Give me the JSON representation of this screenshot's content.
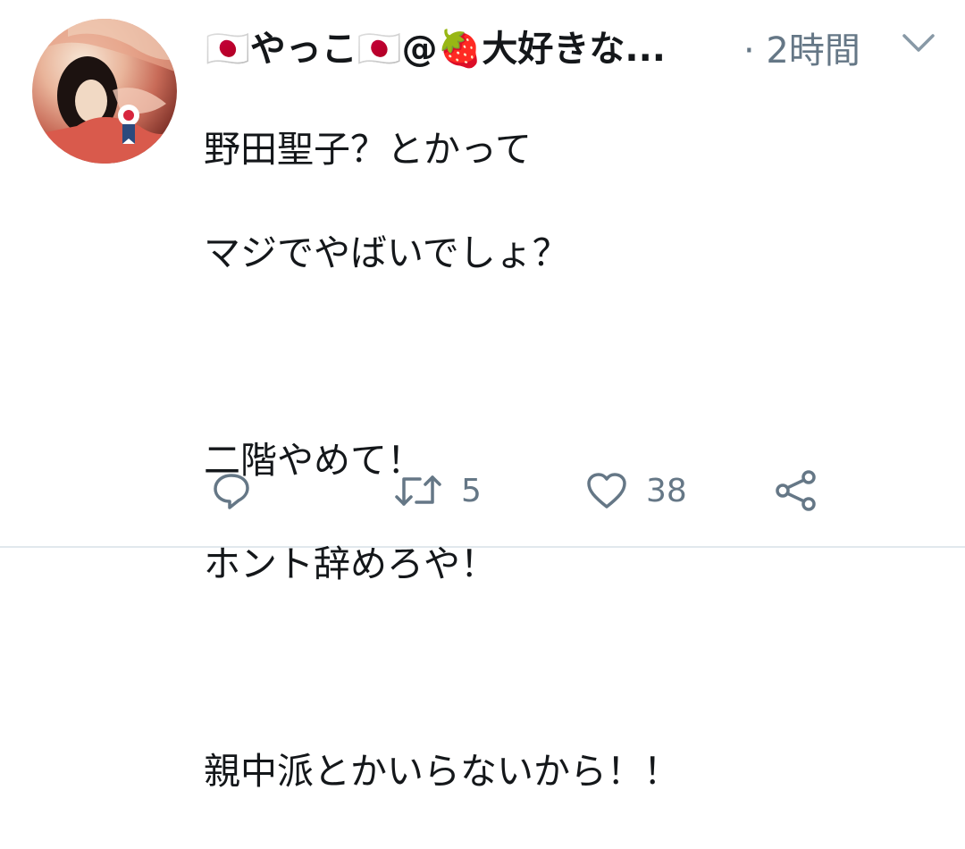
{
  "tweet": {
    "author": {
      "display_name": "🇯🇵やっこ🇯🇵@🍓大好きな...",
      "avatar_icon": "portrait-avatar"
    },
    "time": "· 2時間",
    "body_lines": [
      "野田聖子？とかって",
      "マジでやばいでしょ？",
      "",
      "二階やめて！",
      "ホント辞めろや！",
      "",
      "親中派とかいらないから！！"
    ],
    "actions": {
      "reply": {
        "icon": "reply-icon",
        "count": ""
      },
      "retweet": {
        "icon": "retweet-icon",
        "count": "5"
      },
      "like": {
        "icon": "heart-icon",
        "count": "38"
      },
      "share": {
        "icon": "share-icon"
      }
    }
  },
  "colors": {
    "text": "#14171a",
    "muted": "#657786",
    "divider": "#e1e8ed"
  }
}
